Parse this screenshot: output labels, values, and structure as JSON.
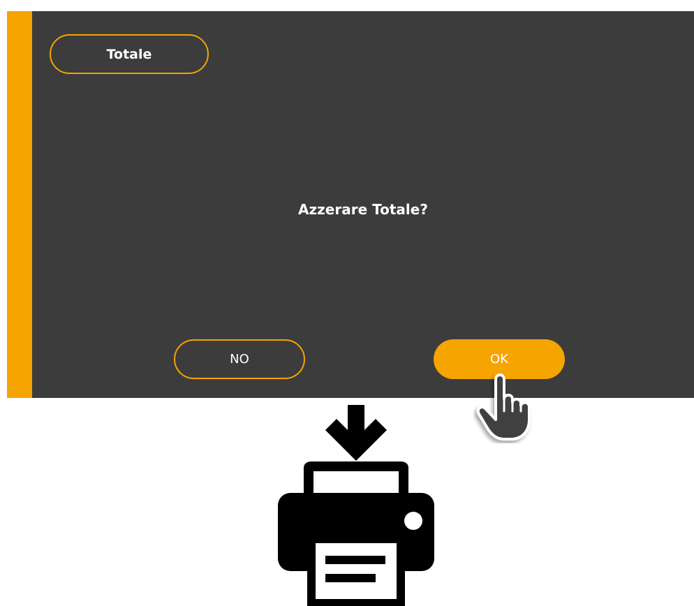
{
  "dialog": {
    "title": "Totale",
    "message": "Azzerare Totale?",
    "no_label": "NO",
    "ok_label": "OK"
  },
  "colors": {
    "accent": "#f5a400",
    "panel_background": "#3c3c3c",
    "text": "#ffffff",
    "illustration": "#000000"
  },
  "icons": {
    "pointer": "pointing-hand-icon",
    "print": "printer-icon",
    "arrow": "down-arrow-icon"
  }
}
